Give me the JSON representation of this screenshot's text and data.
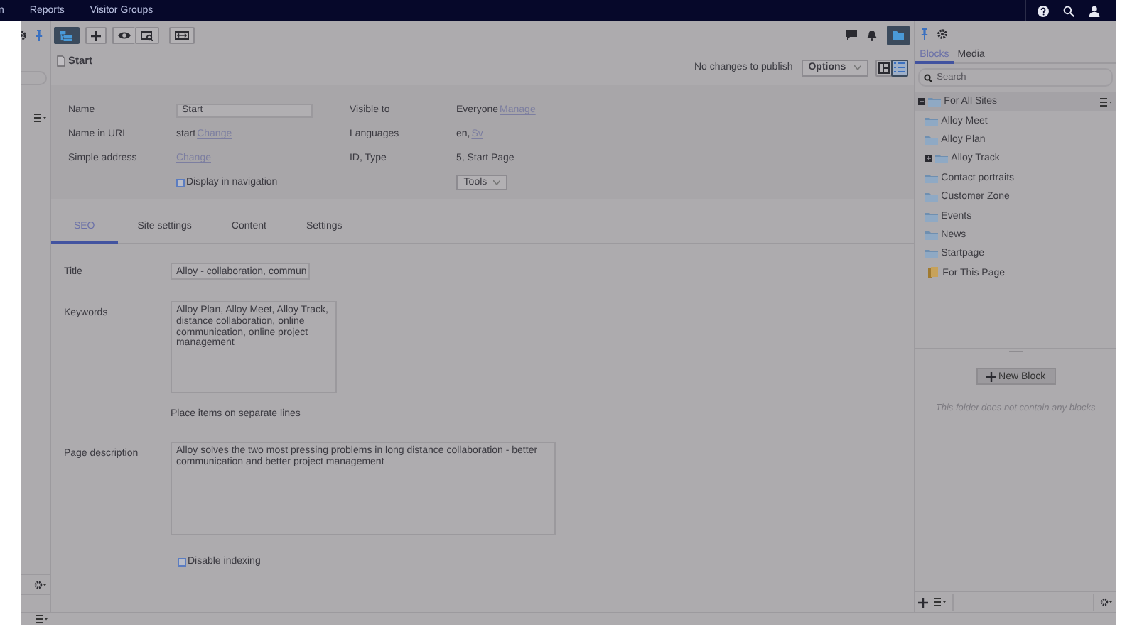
{
  "top_nav": {
    "items": [
      {
        "label": "n"
      },
      {
        "label": "Reports"
      },
      {
        "label": "Visitor Groups"
      }
    ]
  },
  "toolbar": {
    "tree_toggle": {
      "selected": true
    },
    "assets_toggle": {
      "selected": true
    }
  },
  "page": {
    "title": "Start",
    "publish_status": "No changes to publish",
    "options_button": "Options",
    "view_modes": [
      {
        "kind": "split",
        "selected": false
      },
      {
        "kind": "list",
        "selected": true
      }
    ]
  },
  "properties": {
    "left": [
      {
        "label": "Name",
        "kind": "field",
        "value": "Start"
      },
      {
        "label": "Name in URL",
        "kind": "link-text",
        "text": "start",
        "link": "Change"
      },
      {
        "label": "Simple address",
        "kind": "link",
        "link": "Change"
      }
    ],
    "display_in_navigation": {
      "label": "Display in navigation",
      "checked": false
    },
    "right": [
      {
        "label": "Visible to",
        "text": "Everyone",
        "link": "Manage"
      },
      {
        "label": "Languages",
        "text": "en,",
        "link": "Sv"
      },
      {
        "label": "ID, Type",
        "text": "5, Start Page"
      }
    ],
    "tools_button": "Tools"
  },
  "tabs": [
    {
      "label": "SEO",
      "selected": true
    },
    {
      "label": "Site settings",
      "selected": false
    },
    {
      "label": "Content",
      "selected": false
    },
    {
      "label": "Settings",
      "selected": false
    }
  ],
  "seo": {
    "title": {
      "label": "Title",
      "value": "Alloy - collaboration, commun"
    },
    "keywords": {
      "label": "Keywords",
      "value": "Alloy Plan, Alloy Meet, Alloy Track, distance collaboration, online communication, online project management",
      "hint": "Place items on separate lines"
    },
    "page_description": {
      "label": "Page description",
      "value": "Alloy solves the two most pressing problems in long distance collaboration - better communication and better project management"
    },
    "disable_indexing": {
      "label": "Disable indexing",
      "checked": false
    }
  },
  "assets": {
    "tabs": [
      {
        "label": "Blocks",
        "selected": true
      },
      {
        "label": "Media",
        "selected": false
      }
    ],
    "search": {
      "placeholder": "Search"
    },
    "tree": [
      {
        "label": "For All Sites",
        "kind": "shared",
        "expanded": true,
        "selected": true,
        "children": [
          {
            "label": "Alloy Meet",
            "selected": false
          },
          {
            "label": "Alloy Plan",
            "selected": false
          },
          {
            "label": "Alloy Track",
            "expanded": false,
            "selected": false
          },
          {
            "label": "Contact portraits",
            "selected": false
          },
          {
            "label": "Customer Zone",
            "selected": false
          },
          {
            "label": "Events",
            "selected": false
          },
          {
            "label": "News",
            "selected": false
          },
          {
            "label": "Startpage",
            "selected": false
          }
        ]
      },
      {
        "label": "For This Page",
        "kind": "local",
        "selected": false
      }
    ],
    "new_block_button": "New Block",
    "empty_message": "This folder does not contain any blocks"
  }
}
